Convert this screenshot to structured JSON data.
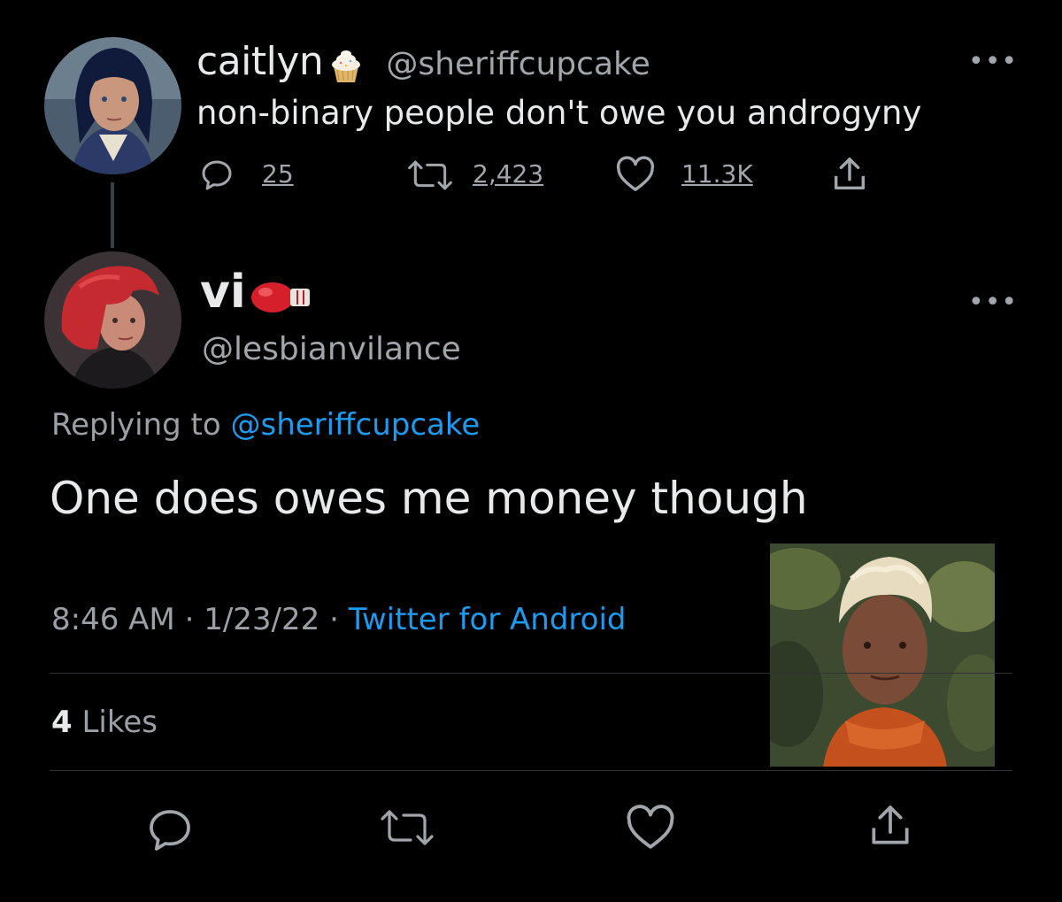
{
  "parent_tweet": {
    "display_name": "caitlyn",
    "name_emoji": "cupcake-emoji",
    "handle": "@sheriffcupcake",
    "text": "non-binary people don't owe you androgyny",
    "replies": "25",
    "retweets": "2,423",
    "likes": "11.3K",
    "more": "•••"
  },
  "reply_tweet": {
    "display_name": "vi",
    "name_emoji": "boxing-glove-emoji",
    "handle": "@lesbianvilance",
    "replying_prefix": "Replying to",
    "replying_handle": "@sheriffcupcake",
    "text": "One does owes me money though",
    "time": "8:46 AM",
    "date": "1/23/22",
    "source": "Twitter for Android",
    "sep": "·",
    "likes_count": "4",
    "likes_label": "Likes",
    "more": "•••"
  },
  "colors": {
    "background": "#000000",
    "text": "#e7e9ea",
    "muted": "#9aa0a6",
    "link": "#1d9bf0",
    "divider": "#2f3336"
  }
}
